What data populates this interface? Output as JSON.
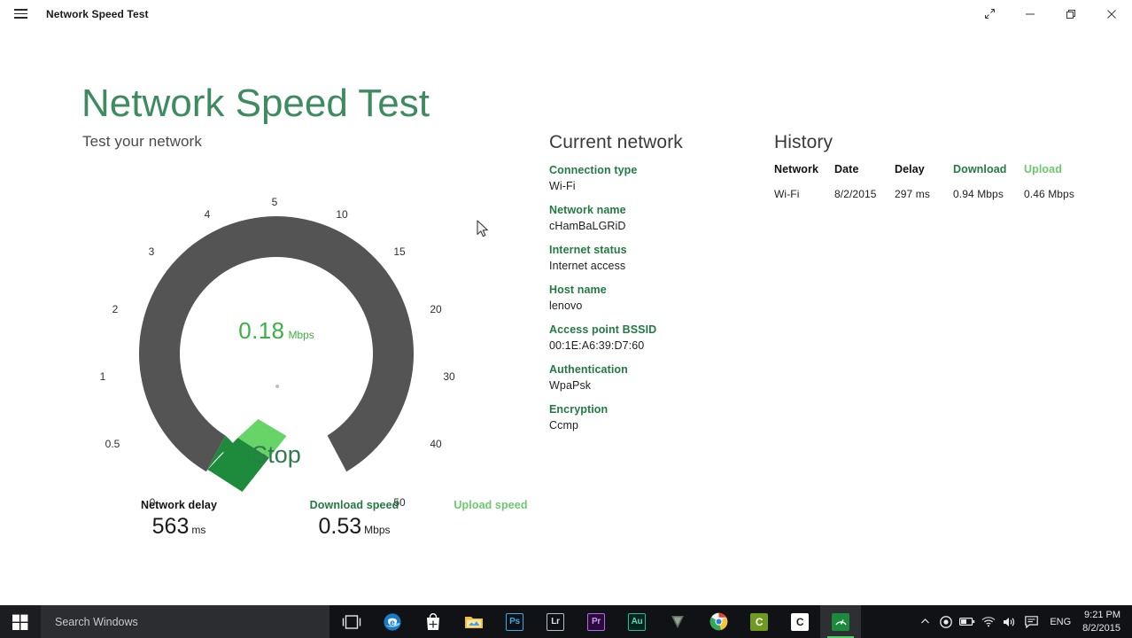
{
  "window": {
    "title": "Network Speed Test",
    "menu_icon": "hamburger-icon",
    "controls": {
      "fullscreen": "fullscreen-icon",
      "minimize": "minimize-icon",
      "restore": "restore-icon",
      "close": "close-icon"
    }
  },
  "app": {
    "title": "Network Speed Test",
    "subtitle": "Test your network",
    "accent_green": "#3d8b5f",
    "download_green": "#237a43",
    "upload_green": "#6dc96d"
  },
  "gauge": {
    "value": "0.18",
    "unit": "Mbps",
    "action_label": "Stop",
    "ticks": [
      "0",
      "0.5",
      "1",
      "2",
      "3",
      "4",
      "5",
      "10",
      "15",
      "20",
      "30",
      "40",
      "50"
    ],
    "arc_color": "#545454",
    "download_arc_color": "#1d8a3c",
    "upload_arc_color": "#66d466"
  },
  "stats": {
    "delay": {
      "label": "Network delay",
      "value": "563",
      "unit": "ms"
    },
    "download": {
      "label": "Download speed",
      "value": "0.53",
      "unit": "Mbps"
    },
    "upload": {
      "label": "Upload speed",
      "value": "",
      "unit": ""
    }
  },
  "current_network": {
    "heading": "Current network",
    "items": [
      {
        "key": "Connection type",
        "value": "Wi-Fi"
      },
      {
        "key": "Network name",
        "value": "cHamBaLGRiD"
      },
      {
        "key": "Internet status",
        "value": "Internet access"
      },
      {
        "key": "Host name",
        "value": "lenovo"
      },
      {
        "key": "Access point BSSID",
        "value": "00:1E:A6:39:D7:60"
      },
      {
        "key": "Authentication",
        "value": "WpaPsk"
      },
      {
        "key": "Encryption",
        "value": "Ccmp"
      }
    ]
  },
  "history": {
    "heading": "History",
    "columns": [
      "Network",
      "Date",
      "Delay",
      "Download",
      "Upload"
    ],
    "rows": [
      {
        "network": "Wi-Fi",
        "date": "8/2/2015",
        "delay": "297 ms",
        "download": "0.94 Mbps",
        "upload": "0.46 Mbps"
      }
    ]
  },
  "taskbar": {
    "start": "windows-start-icon",
    "search_placeholder": "Search Windows",
    "apps": [
      {
        "name": "task-view",
        "label": ""
      },
      {
        "name": "internet-explorer",
        "label": ""
      },
      {
        "name": "microsoft-store",
        "label": ""
      },
      {
        "name": "file-explorer",
        "label": ""
      },
      {
        "name": "photoshop",
        "label": "Ps"
      },
      {
        "name": "lightroom",
        "label": "Lr"
      },
      {
        "name": "premiere-pro",
        "label": "Pr"
      },
      {
        "name": "audition",
        "label": "Au"
      },
      {
        "name": "vegas",
        "label": "V"
      },
      {
        "name": "chrome",
        "label": ""
      },
      {
        "name": "camtasia-recorder",
        "label": "C"
      },
      {
        "name": "camtasia-studio",
        "label": "C"
      },
      {
        "name": "network-speed-test",
        "label": ""
      }
    ],
    "tray": {
      "language": "ENG",
      "time": "9:21 PM",
      "date": "8/2/2015"
    }
  }
}
